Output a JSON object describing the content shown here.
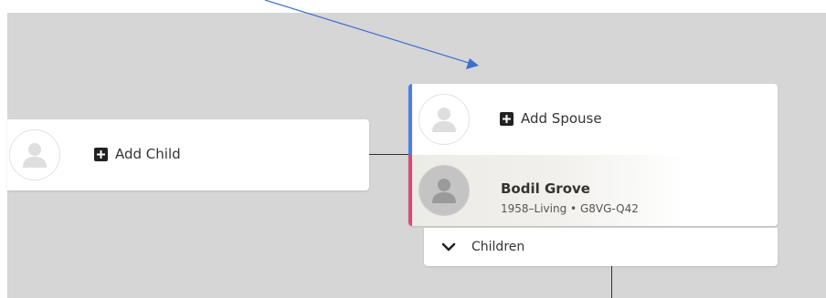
{
  "child_card": {
    "add_label": "Add Child"
  },
  "couple_card": {
    "spouse_add_label": "Add Spouse",
    "person": {
      "name": "Bodil Grove",
      "lifespan": "1958–Living",
      "separator": " • ",
      "id": "G8VG-Q42"
    }
  },
  "children_toggle": {
    "label": "Children"
  },
  "colors": {
    "canvas": "#d6d6d6",
    "spouse_accent": "#4a7fe8",
    "person_accent": "#e0457a",
    "annotation_arrow": "#3b6fd0"
  },
  "icons": {
    "avatar": "person-silhouette-icon",
    "add": "plus-square-icon",
    "toggle": "chevron-down-icon"
  }
}
